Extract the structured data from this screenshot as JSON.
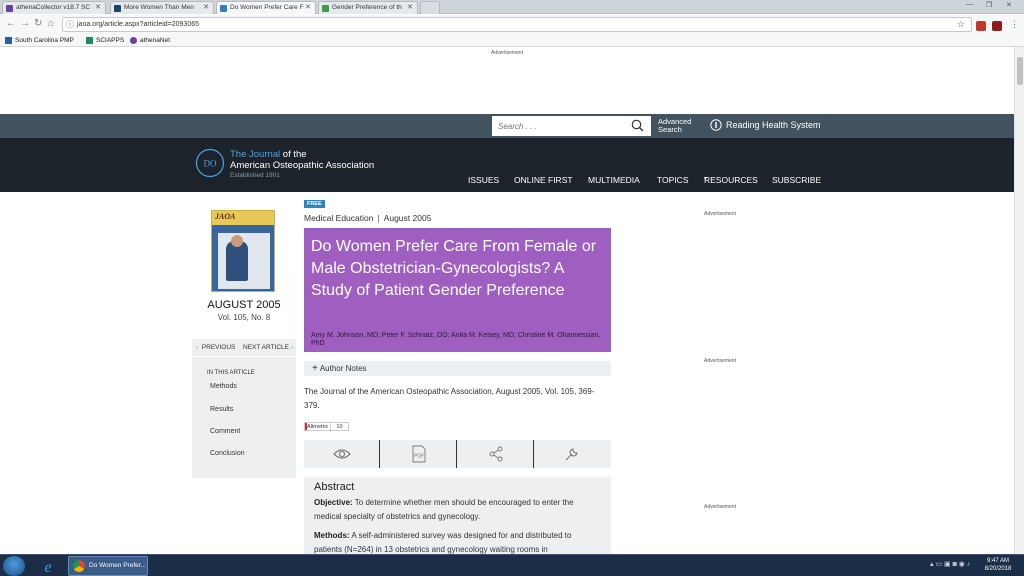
{
  "browser": {
    "tabs": [
      {
        "label": "athenaCollector v18.7 SC",
        "active": false
      },
      {
        "label": "More Women Than Men",
        "active": false
      },
      {
        "label": "Do Women Prefer Care F",
        "active": true
      },
      {
        "label": "Gender Preference of th",
        "active": false
      }
    ],
    "url": "jaoa.org/article.aspx?articleid=2093065",
    "bookmarks": [
      "South Carolina PMP",
      "SCIAPPS",
      "athenaNet"
    ]
  },
  "ads": {
    "label": "Advertisement"
  },
  "header": {
    "search_placeholder": "Search . . .",
    "advanced_line1": "Advanced",
    "advanced_line2": "Search",
    "institution": "Reading Health System"
  },
  "logo": {
    "accent": "The Journal",
    "of_the": " of the",
    "line2": "American Osteopathic Association",
    "line3": "Established 1901"
  },
  "nav": {
    "items": [
      "ISSUES",
      "ONLINE FIRST",
      "MULTIMEDIA",
      "TOPICS",
      "RESOURCES",
      "SUBSCRIBE"
    ]
  },
  "issue": {
    "cover_title": "JAOA",
    "month": "AUGUST 2005",
    "volume": "Vol. 105, No. 8"
  },
  "sidebar": {
    "previous": "PREVIOUS",
    "next": "NEXT ARTICLE",
    "in_this_article": "IN THIS ARTICLE",
    "toc": [
      "Methods",
      "Results",
      "Comment",
      "Conclusion"
    ]
  },
  "article": {
    "badge": "FREE",
    "section": "Medical Education",
    "date": "August 2005",
    "title": "Do Women Prefer Care From Female or Male Obstetrician-Gynecologists? A Study of Patient Gender Preference",
    "authors": "Amy M. Johnson, MD; Peter F. Schnatz, DO; Anita M. Kelsey, MD; Christine M. Ohannessian, PhD",
    "author_notes": "Author Notes",
    "citation": "The Journal of the American Osteopathic Association, August 2005, Vol. 105, 369-379.",
    "altmetric_label": "Altmetric",
    "altmetric_count": "10",
    "pdf_label": "PDF"
  },
  "abstract": {
    "heading": "Abstract",
    "objective_label": "Objective:",
    "objective_text": " To determine whether men should be encouraged to enter the medical specialty of obstetrics and gynecology.",
    "methods_label": "Methods:",
    "methods_text": " A self-administered survey was designed for and distributed to patients (N=264) in 13 obstetrics and gynecology waiting rooms in"
  },
  "taskbar": {
    "chrome_label": "Do Women Prefer...",
    "time": "9:47 AM",
    "date": "8/20/2018"
  },
  "colors": {
    "title_box": "#9e5fc1",
    "topbar": "#43525f",
    "navbar": "#1d232b",
    "accent_blue": "#4aa3df"
  }
}
